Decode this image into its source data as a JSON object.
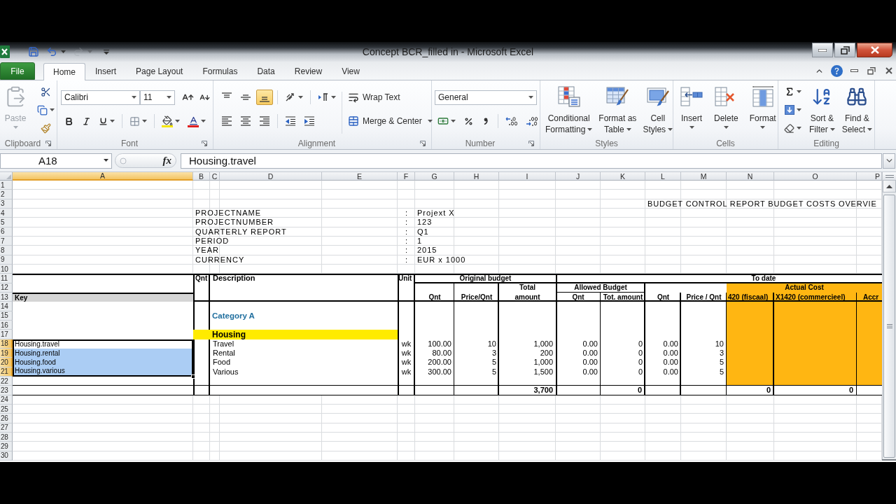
{
  "window": {
    "title": "Concept BCR_filled in - Microsoft Excel"
  },
  "quick_access": [
    {
      "kind": "save",
      "disabled": false
    },
    {
      "kind": "undo",
      "disabled": false
    },
    {
      "kind": "redo",
      "disabled": true
    }
  ],
  "ribbon_tabs": [
    {
      "label": "File",
      "kind": "file",
      "selected": false
    },
    {
      "label": "Home",
      "kind": "tab",
      "selected": true
    },
    {
      "label": "Insert",
      "kind": "tab",
      "selected": false
    },
    {
      "label": "Page Layout",
      "kind": "tab",
      "selected": false
    },
    {
      "label": "Formulas",
      "kind": "tab",
      "selected": false
    },
    {
      "label": "Data",
      "kind": "tab",
      "selected": false
    },
    {
      "label": "Review",
      "kind": "tab",
      "selected": false
    },
    {
      "label": "View",
      "kind": "tab",
      "selected": false
    }
  ],
  "ribbon_groups": [
    {
      "kind": "clipboard",
      "label": "Clipboard",
      "launcher": true,
      "paste": {
        "label": "Paste",
        "disabled": true
      }
    },
    {
      "kind": "font",
      "label": "Font",
      "launcher": true,
      "font_name": "Calibri",
      "font_size": "11"
    },
    {
      "kind": "alignment",
      "label": "Alignment",
      "launcher": true,
      "vertical": [
        {
          "kind": "top",
          "selected": false
        },
        {
          "kind": "middle",
          "selected": false
        },
        {
          "kind": "bottom",
          "selected": true
        }
      ],
      "horizontal": [
        {
          "kind": "left",
          "selected": false
        },
        {
          "kind": "center",
          "selected": false
        },
        {
          "kind": "right",
          "selected": false
        }
      ],
      "wrap_text": "Wrap Text",
      "merge": "Merge & Center"
    },
    {
      "kind": "number",
      "label": "Number",
      "launcher": true,
      "format": "General"
    },
    {
      "kind": "styles",
      "label": "Styles",
      "buttons": [
        {
          "kind": "conditional_formatting",
          "lines": [
            "Conditional",
            "Formatting"
          ]
        },
        {
          "kind": "format_as_table",
          "lines": [
            "Format as",
            "Table"
          ]
        },
        {
          "kind": "cell_styles",
          "lines": [
            "Cell",
            "Styles"
          ]
        }
      ]
    },
    {
      "kind": "cells",
      "label": "Cells",
      "buttons": [
        {
          "kind": "insert",
          "lines": [
            "Insert"
          ]
        },
        {
          "kind": "delete",
          "lines": [
            "Delete"
          ]
        },
        {
          "kind": "format",
          "lines": [
            "Format"
          ]
        }
      ]
    },
    {
      "kind": "editing",
      "label": "Editing",
      "buttons": [
        {
          "kind": "sort_filter",
          "lines": [
            "Sort &",
            "Filter"
          ]
        },
        {
          "kind": "find_select",
          "lines": [
            "Find &",
            "Select"
          ]
        }
      ]
    }
  ],
  "formula_bar": {
    "name_box": "A18",
    "function_label": "fx",
    "formula": "Housing.travel"
  },
  "sheet": {
    "columns": [
      {
        "label": "A",
        "selected": true
      },
      {
        "label": "B",
        "selected": false
      },
      {
        "label": "C",
        "selected": false
      },
      {
        "label": "D",
        "selected": false
      },
      {
        "label": "E",
        "selected": false
      },
      {
        "label": "F",
        "selected": false
      },
      {
        "label": "G",
        "selected": false
      },
      {
        "label": "H",
        "selected": false
      },
      {
        "label": "I",
        "selected": false
      },
      {
        "label": "J",
        "selected": false
      },
      {
        "label": "K",
        "selected": false
      },
      {
        "label": "L",
        "selected": false
      },
      {
        "label": "M",
        "selected": false
      },
      {
        "label": "N",
        "selected": false
      },
      {
        "label": "O",
        "selected": false
      },
      {
        "label": "P",
        "selected": false
      }
    ],
    "rows": [
      {
        "label": "1",
        "selected": false
      },
      {
        "label": "2",
        "selected": false
      },
      {
        "label": "3",
        "selected": false
      },
      {
        "label": "4",
        "selected": false
      },
      {
        "label": "5",
        "selected": false
      },
      {
        "label": "6",
        "selected": false
      },
      {
        "label": "7",
        "selected": false
      },
      {
        "label": "8",
        "selected": false
      },
      {
        "label": "9",
        "selected": false
      },
      {
        "label": "10",
        "selected": false
      },
      {
        "label": "11",
        "selected": false
      },
      {
        "label": "12",
        "selected": false
      },
      {
        "label": "13",
        "selected": false
      },
      {
        "label": "14",
        "selected": false
      },
      {
        "label": "15",
        "selected": false
      },
      {
        "label": "16",
        "selected": false
      },
      {
        "label": "17",
        "selected": false
      },
      {
        "label": "18",
        "selected": true
      },
      {
        "label": "19",
        "selected": true
      },
      {
        "label": "20",
        "selected": true
      },
      {
        "label": "21",
        "selected": true
      },
      {
        "label": "22",
        "selected": false
      },
      {
        "label": "23",
        "selected": false
      },
      {
        "label": "24",
        "selected": false
      },
      {
        "label": "25",
        "selected": false
      },
      {
        "label": "26",
        "selected": false
      },
      {
        "label": "27",
        "selected": false
      },
      {
        "label": "28",
        "selected": false
      },
      {
        "label": "29",
        "selected": false
      },
      {
        "label": "30",
        "selected": false
      }
    ],
    "report_title": "BUDGET CONTROL REPORT BUDGET COSTS OVERVIE",
    "project_info": [
      {
        "label": "PROJECTNAME",
        "separator": ":",
        "value": "Projext X"
      },
      {
        "label": "PROJECTNUMBER",
        "separator": ":",
        "value": "123"
      },
      {
        "label": "QUARTERLY REPORT",
        "separator": ":",
        "value": "Q1"
      },
      {
        "label": "PERIOD",
        "separator": ":",
        "value": "1"
      },
      {
        "label": "YEAR",
        "separator": ":",
        "value": "2015"
      },
      {
        "label": "CURRENCY",
        "separator": ":",
        "value": "EUR x 1000"
      }
    ],
    "table": {
      "headers": {
        "qnt": "Qnt",
        "description": "Description",
        "unit": "Unit",
        "original_budget": "Original budget",
        "to_date": "To date",
        "total": "Total",
        "allowed_budget": "Allowed Budget",
        "actual_cost": "Actual Cost",
        "key": "Key",
        "sub_columns": [
          "Qnt",
          "Price/Qnt",
          "amount",
          "Qnt",
          "Tot. amount",
          "Qnt",
          "Price / Qnt",
          "420 (fiscaal)",
          "X1420 (commercieel)",
          "Accr"
        ]
      },
      "category": "Category A",
      "group": "Housing",
      "lines": [
        {
          "key": "Housing.travel",
          "selected": true,
          "active": true,
          "description": "Travel",
          "unit": "wk",
          "values": [
            "100.00",
            "10",
            "1,000",
            "0.00",
            "0",
            "0.00",
            "10"
          ]
        },
        {
          "key": "Housing.rental",
          "selected": true,
          "active": false,
          "description": "Rental",
          "unit": "wk",
          "values": [
            "80.00",
            "3",
            "200",
            "0.00",
            "0",
            "0.00",
            "3"
          ]
        },
        {
          "key": "Housing.food",
          "selected": true,
          "active": false,
          "description": "Food",
          "unit": "wk",
          "values": [
            "200.00",
            "5",
            "1,000",
            "0.00",
            "0",
            "0.00",
            "5"
          ]
        },
        {
          "key": "Housing.various",
          "selected": true,
          "active": false,
          "description": "Various",
          "unit": "wk",
          "values": [
            "300.00",
            "5",
            "1,500",
            "0.00",
            "0",
            "0.00",
            "5"
          ]
        }
      ],
      "totals": {
        "total_amount": "3,700",
        "allowed_total": "0",
        "actual_fiscal": "0",
        "actual_commercial": "0"
      }
    }
  }
}
